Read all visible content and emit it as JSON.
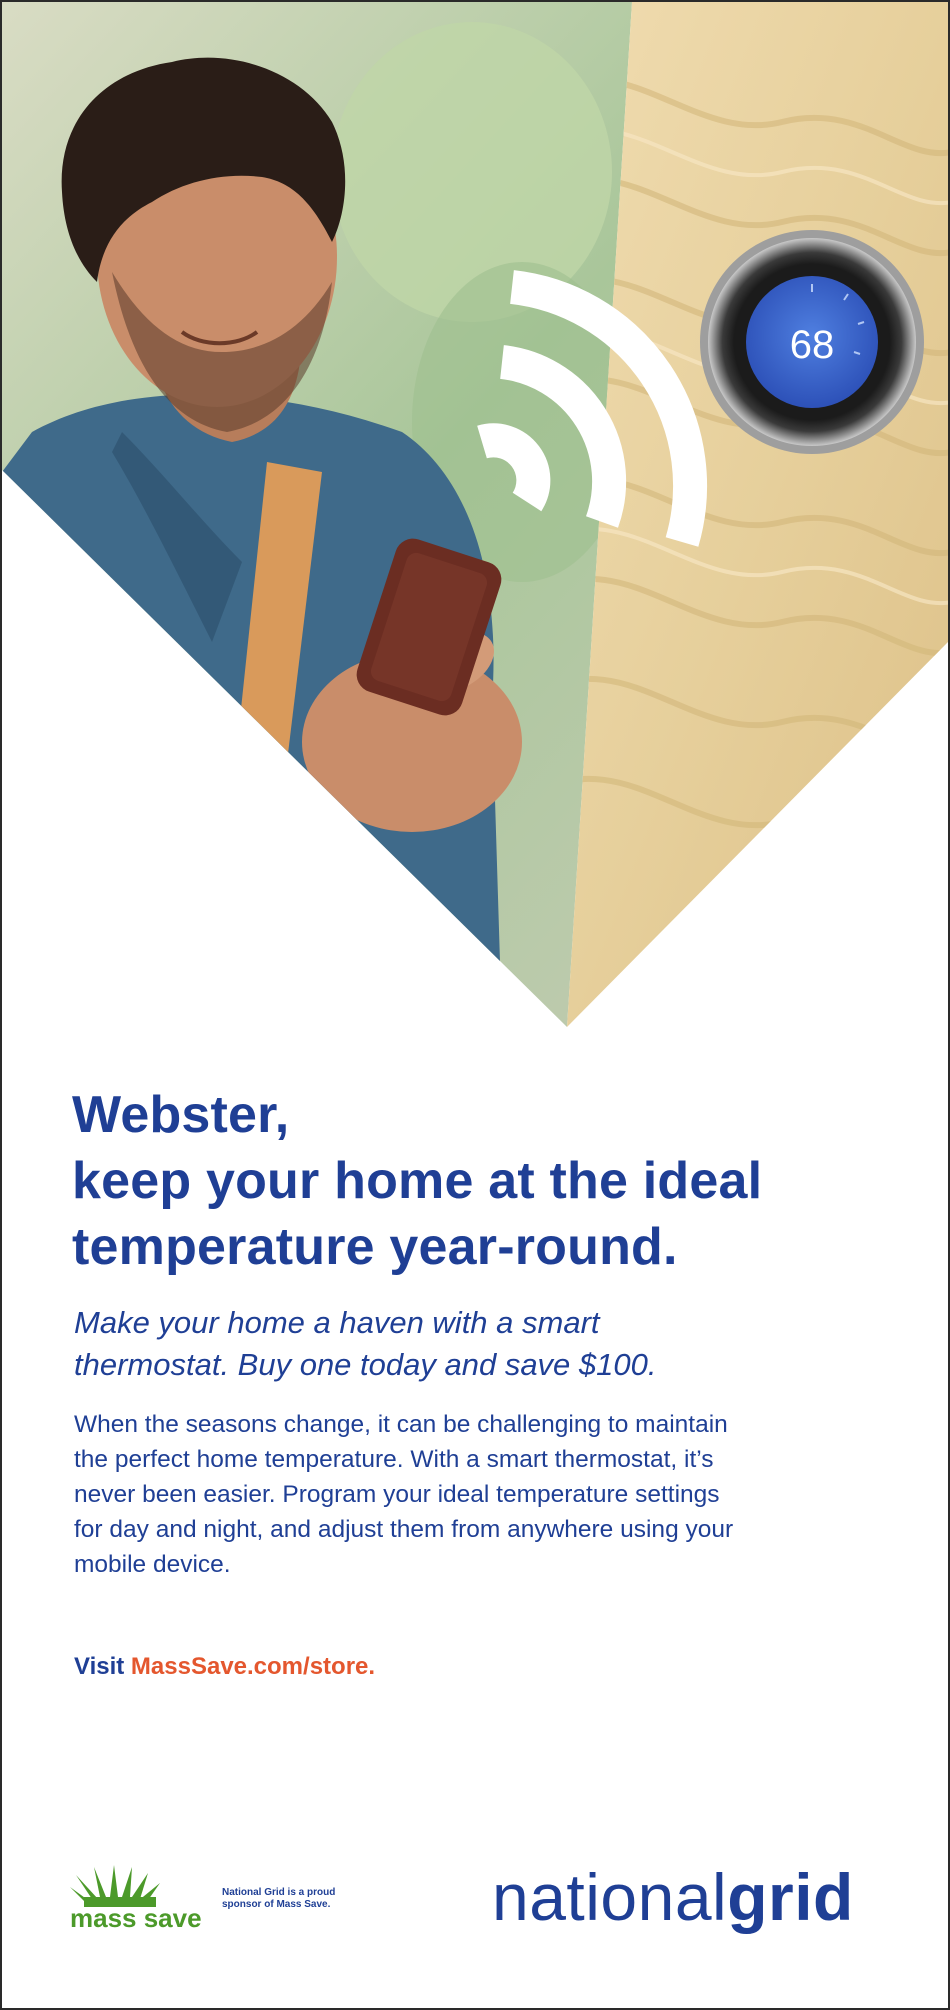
{
  "hero": {
    "thermostat_temp": "68",
    "colors": {
      "wood": "#e8d3a2",
      "wood_dark": "#d3b77b",
      "sky": "#c9d7c4",
      "shirt": "#3f6a8a",
      "strap": "#d99a5b",
      "phone": "#6b2d22",
      "skin": "#c98d6a",
      "hair": "#2a1d17",
      "thermostat_screen": "#3d66c9"
    },
    "icons": [
      "wifi-signal-icon",
      "thermostat-icon",
      "smartphone-icon"
    ]
  },
  "headline": {
    "line1": "Webster,",
    "line2": "keep your home at the ideal",
    "line3": "temperature year-round."
  },
  "subhead": {
    "line1": "Make your home a haven with a smart",
    "line2": "thermostat. Buy one today and save $100."
  },
  "body": {
    "line1": "When the seasons change, it can be challenging to maintain",
    "line2": "the perfect home temperature. With a smart thermostat, it’s",
    "line3": "never been easier. Program your ideal temperature settings",
    "line4": "for day and night, and adjust them from anywhere using your",
    "line5": "mobile device."
  },
  "cta": {
    "visit": "Visit ",
    "link": "MassSave.com/store."
  },
  "footer": {
    "mass_save_logo": "mass save",
    "sponsor_line1": "National Grid is a proud",
    "sponsor_line2": "sponsor of Mass Save.",
    "national_grid_light": "national",
    "national_grid_bold": "grid"
  },
  "brand_colors": {
    "primary_blue": "#1f3f95",
    "accent_orange": "#e4572e",
    "mass_save_green": "#4c9a2a"
  }
}
